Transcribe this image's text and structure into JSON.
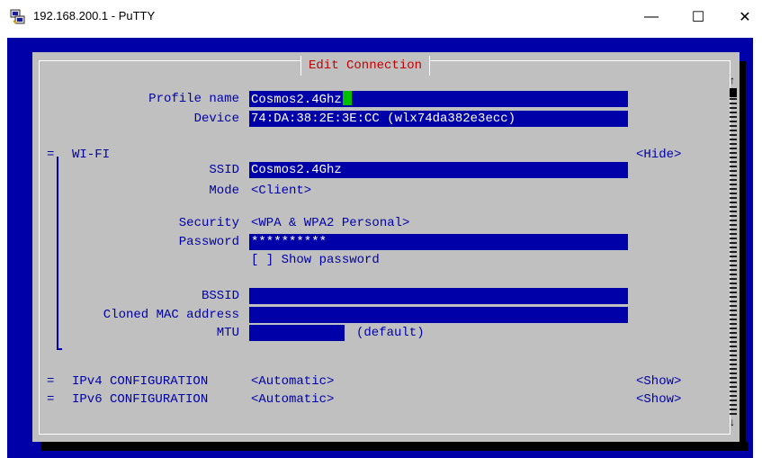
{
  "window": {
    "title": "192.168.200.1 - PuTTY",
    "minimize_glyph": "—",
    "maximize_glyph": "☐",
    "close_glyph": "✕"
  },
  "dialog": {
    "title": "Edit Connection",
    "profile_name_label": "Profile name",
    "profile_name_value": "Cosmos2.4Ghz",
    "device_label": "Device",
    "device_value": "74:DA:38:2E:3E:CC (wlx74da382e3ecc)",
    "wifi": {
      "header": "WI-FI",
      "toggle": "<Hide>",
      "ssid_label": "SSID",
      "ssid_value": "Cosmos2.4Ghz",
      "mode_label": "Mode",
      "mode_value": "<Client>",
      "security_label": "Security",
      "security_value": "<WPA & WPA2 Personal>",
      "password_label": "Password",
      "password_value": "**********",
      "show_password": "[ ] Show password",
      "bssid_label": "BSSID",
      "bssid_value": "",
      "cloned_mac_label": "Cloned MAC address",
      "cloned_mac_value": "",
      "mtu_label": "MTU",
      "mtu_value": "",
      "mtu_hint": "(default)"
    },
    "ipv4": {
      "label": "IPv4 CONFIGURATION",
      "value": "<Automatic>",
      "toggle": "<Show>"
    },
    "ipv6": {
      "label": "IPv6 CONFIGURATION",
      "value": "<Automatic>",
      "toggle": "<Show>"
    },
    "section_marker": "=",
    "scroll_up": "↑",
    "scroll_down": "↓"
  },
  "colors": {
    "terminal_bg": "#0000a8",
    "dialog_bg": "#c0c0c0",
    "title_text": "#c00000",
    "cursor": "#00c000"
  }
}
